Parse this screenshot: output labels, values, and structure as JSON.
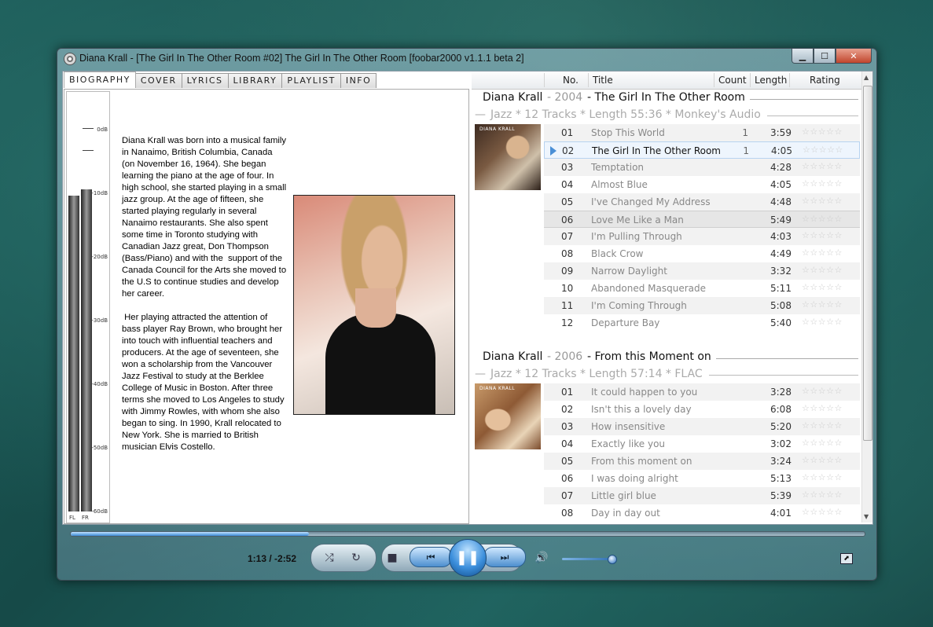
{
  "window": {
    "title": "Diana Krall - [The Girl In The Other Room #02] The Girl In The Other Room   [foobar2000 v1.1.1 beta 2]",
    "minimize": "▁",
    "maximize": "☐",
    "close": "✕"
  },
  "tabs": [
    "BIOGRAPHY",
    "COVER",
    "LYRICS",
    "LIBRARY",
    "PLAYLIST",
    "INFO"
  ],
  "vu": {
    "ticks": [
      "0dB",
      "-10dB",
      "-20dB",
      "-30dB",
      "-40dB",
      "-50dB",
      "-60dB"
    ],
    "channels": [
      "FL",
      "FR"
    ],
    "levels": [
      0.87,
      0.89
    ]
  },
  "biography": "Diana Krall was born into a musical family in Nanaimo, British Columbia, Canada (on November 16, 1964). She began learning the piano at the age of four. In high school, she started playing in a small jazz group. At the age of fifteen, she started playing regularly in several Nanaimo restaurants. She also spent some time in Toronto studying with Canadian Jazz great, Don Thompson (Bass/Piano) and with the  support of the Canada Council for the Arts she moved to the U.S to continue studies and develop her career.\n\n Her playing attracted the attention of bass player Ray Brown, who brought her into touch with influential teachers and producers. At the age of seventeen, she won a scholarship from the Vancouver Jazz Festival to study at the Berklee College of Music in Boston. After three terms she moved to Los Angeles to study with Jimmy Rowles, with whom she also began to sing. In 1990, Krall relocated to New York. She is married to British musician Elvis Costello.",
  "playlist": {
    "columns": {
      "no": "No.",
      "title": "Title",
      "count": "Count",
      "length": "Length",
      "rating": "Rating"
    },
    "groups": [
      {
        "artist": "Diana Krall",
        "year": "2004",
        "album": "The Girl In The Other Room",
        "subtitle": "Jazz * 12 Tracks * Length 55:36 * Monkey's Audio",
        "cover_label": "DIANA KRALL",
        "tracks": [
          {
            "no": "01",
            "title": "Stop This World",
            "count": "1",
            "length": "3:59",
            "stars": "☆☆☆☆☆"
          },
          {
            "no": "02",
            "title": "The Girl In The Other Room",
            "count": "1",
            "length": "4:05",
            "stars": "☆☆☆☆☆"
          },
          {
            "no": "03",
            "title": "Temptation",
            "count": "",
            "length": "4:28",
            "stars": "☆☆☆☆☆"
          },
          {
            "no": "04",
            "title": "Almost Blue",
            "count": "",
            "length": "4:05",
            "stars": "☆☆☆☆☆"
          },
          {
            "no": "05",
            "title": "I've Changed My Address",
            "count": "",
            "length": "4:48",
            "stars": "☆☆☆☆☆"
          },
          {
            "no": "06",
            "title": "Love Me Like a Man",
            "count": "",
            "length": "5:49",
            "stars": "☆☆☆☆☆"
          },
          {
            "no": "07",
            "title": "I'm Pulling Through",
            "count": "",
            "length": "4:03",
            "stars": "☆☆☆☆☆"
          },
          {
            "no": "08",
            "title": "Black Crow",
            "count": "",
            "length": "4:49",
            "stars": "☆☆☆☆☆"
          },
          {
            "no": "09",
            "title": "Narrow Daylight",
            "count": "",
            "length": "3:32",
            "stars": "☆☆☆☆☆"
          },
          {
            "no": "10",
            "title": "Abandoned Masquerade",
            "count": "",
            "length": "5:11",
            "stars": "☆☆☆☆☆"
          },
          {
            "no": "11",
            "title": "I'm Coming Through",
            "count": "",
            "length": "5:08",
            "stars": "☆☆☆☆☆"
          },
          {
            "no": "12",
            "title": "Departure Bay",
            "count": "",
            "length": "5:40",
            "stars": "☆☆☆☆☆"
          }
        ]
      },
      {
        "artist": "Diana Krall",
        "year": "2006",
        "album": "From this Moment on",
        "subtitle": "Jazz * 12 Tracks * Length 57:14 * FLAC",
        "cover_label": "DIANA KRALL",
        "tracks": [
          {
            "no": "01",
            "title": "It could happen to you",
            "count": "",
            "length": "3:28",
            "stars": "☆☆☆☆☆"
          },
          {
            "no": "02",
            "title": "Isn't this a lovely day",
            "count": "",
            "length": "6:08",
            "stars": "☆☆☆☆☆"
          },
          {
            "no": "03",
            "title": "How insensitive",
            "count": "",
            "length": "5:20",
            "stars": "☆☆☆☆☆"
          },
          {
            "no": "04",
            "title": "Exactly like you",
            "count": "",
            "length": "3:02",
            "stars": "☆☆☆☆☆"
          },
          {
            "no": "05",
            "title": "From this moment on",
            "count": "",
            "length": "3:24",
            "stars": "☆☆☆☆☆"
          },
          {
            "no": "06",
            "title": "I was doing alright",
            "count": "",
            "length": "5:13",
            "stars": "☆☆☆☆☆"
          },
          {
            "no": "07",
            "title": "Little girl blue",
            "count": "",
            "length": "5:39",
            "stars": "☆☆☆☆☆"
          },
          {
            "no": "08",
            "title": "Day in day out",
            "count": "",
            "length": "4:01",
            "stars": "☆☆☆☆☆"
          }
        ]
      }
    ]
  },
  "transport": {
    "time": "1:13 / -2:52",
    "seek_progress": 0.3,
    "volume": 0.95,
    "shuffle": "⤮",
    "repeat": "↻",
    "stop": "■",
    "prev": "⏮",
    "play_pause": "❚❚",
    "next": "⏭",
    "mute": "🔊",
    "mini": "⬈"
  }
}
